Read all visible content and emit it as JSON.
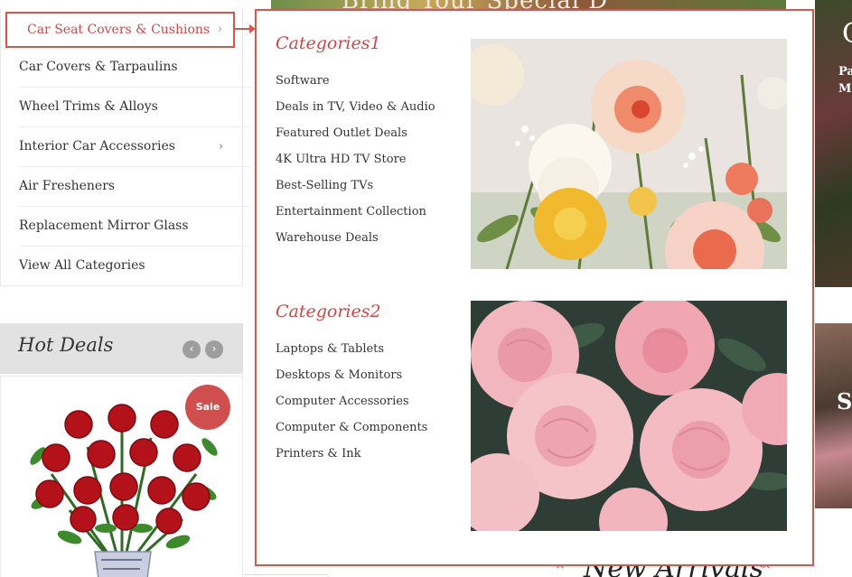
{
  "background": {
    "banner_text": "Bring Your Special D",
    "side_top": {
      "big": "C",
      "line1": "Pa",
      "line2": "M"
    },
    "side_bottom": {
      "big": "SI"
    },
    "new_arrivals_title": "New Arrivals",
    "close_glyph": "×"
  },
  "sidebar": {
    "items": [
      {
        "label": "Car Seat Covers & Cushions",
        "has_submenu": true,
        "active": true
      },
      {
        "label": "Car Covers & Tarpaulins",
        "has_submenu": false
      },
      {
        "label": "Wheel Trims & Alloys",
        "has_submenu": false
      },
      {
        "label": "Interior Car Accessories",
        "has_submenu": true
      },
      {
        "label": "Air Fresheners",
        "has_submenu": false
      },
      {
        "label": "Replacement Mirror Glass",
        "has_submenu": false
      },
      {
        "label": "View All Categories",
        "has_submenu": false
      }
    ],
    "chevron_glyph": "›"
  },
  "mega_menu": {
    "groups": [
      {
        "heading": "Categories1",
        "links": [
          "Software",
          "Deals in TV, Video & Audio",
          "Featured Outlet Deals",
          "4K Ultra HD TV Store",
          "Best-Selling TVs",
          "Entertainment Collection",
          "Warehouse Deals"
        ]
      },
      {
        "heading": "Categories2",
        "links": [
          "Laptops & Tablets",
          "Desktops & Monitors",
          "Computer Accessories",
          "Computer & Components",
          "Printers & Ink"
        ]
      }
    ],
    "images": [
      {
        "icon": "flower-bouquet-photo-icon"
      },
      {
        "icon": "pink-peonies-photo-icon"
      }
    ]
  },
  "hot_deals": {
    "title": "Hot Deals",
    "prev_glyph": "‹",
    "next_glyph": "›",
    "product": {
      "badge": "Sale",
      "icon": "red-roses-bouquet-icon"
    }
  },
  "colors": {
    "accent": "#d9534f",
    "heading_accent": "#c9494a",
    "badge": "#cf4f4f",
    "hot_deals_bar": "#e2e2e2"
  }
}
